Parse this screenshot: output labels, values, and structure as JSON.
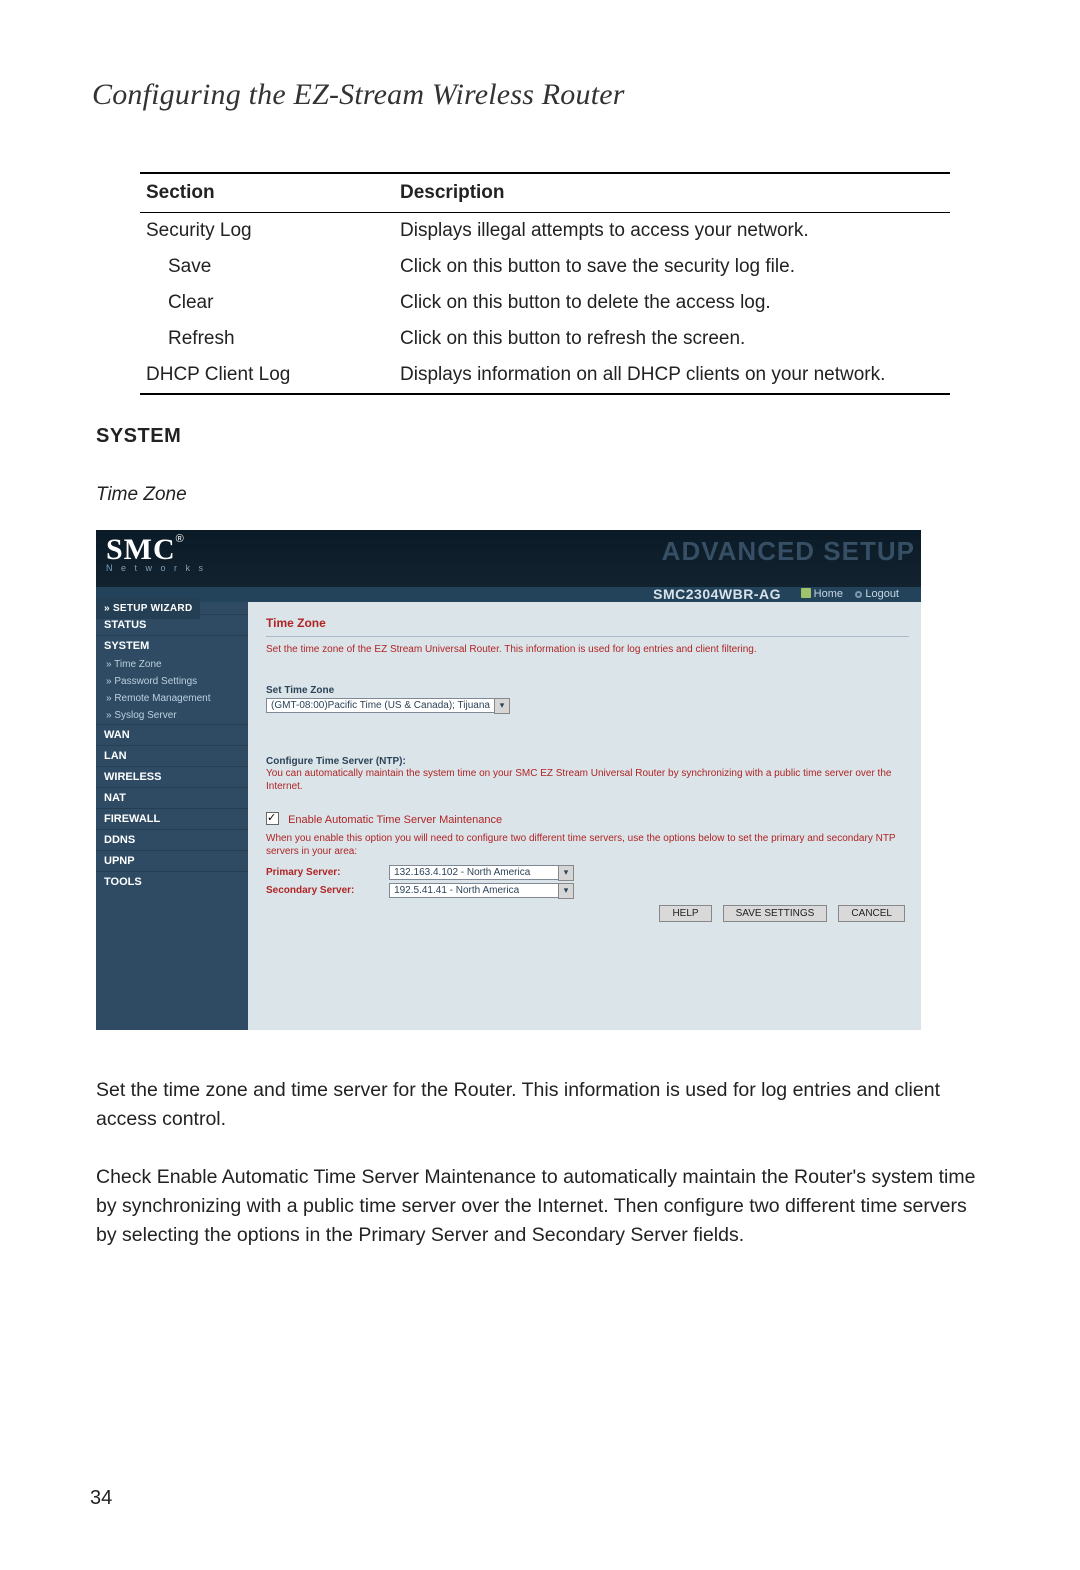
{
  "doc": {
    "page_title": "Configuring the EZ-Stream Wireless Router",
    "table": {
      "headers": {
        "c1": "Section",
        "c2": "Description"
      },
      "rows": [
        {
          "c1": "Security Log",
          "c2": "Displays illegal attempts to access your network."
        },
        {
          "c1": "Save",
          "c2": "Click on this button to save the security log file."
        },
        {
          "c1": "Clear",
          "c2": "Click on this button to delete the access log."
        },
        {
          "c1": "Refresh",
          "c2": "Click on this button to refresh the screen."
        },
        {
          "c1": "DHCP Client Log",
          "c2": "Displays information on all DHCP clients on your network."
        }
      ]
    },
    "section_heading": "SYSTEM",
    "sub_heading": "Time Zone",
    "para1": "Set the time zone and time server for the Router. This information is used for log entries and client access control.",
    "para2": "Check Enable Automatic Time Server Maintenance to automatically maintain the Router's system time by synchronizing with a public time server over the Internet. Then configure two different time servers by selecting the options in the Primary Server and Secondary Server fields.",
    "page_number": "34"
  },
  "shot": {
    "brand": "SMC",
    "brand_sub": "N e t w o r k s",
    "advanced": "ADVANCED SETUP",
    "model": "SMC2304WBR-AG",
    "home": "Home",
    "logout": "Logout",
    "sidebar": {
      "wizard": "» SETUP WIZARD",
      "items": [
        "STATUS",
        "SYSTEM"
      ],
      "subitems": [
        "» Time Zone",
        "» Password Settings",
        "» Remote Management",
        "» Syslog Server"
      ],
      "items2": [
        "WAN",
        "LAN",
        "WIRELESS",
        "NAT",
        "FIREWALL",
        "DDNS",
        "UPnP",
        "TOOLS"
      ]
    },
    "panel": {
      "title": "Time Zone",
      "intro": "Set the time zone of the EZ Stream Universal Router. This information is used for log entries and client filtering.",
      "set_tz_label": "Set Time Zone",
      "tz_value": "(GMT-08:00)Pacific Time (US & Canada); Tijuana",
      "ntp_label": "Configure Time Server (NTP):",
      "ntp_text": "You can automatically maintain the system time on your SMC EZ Stream Universal Router by synchronizing with a public time server over the Internet.",
      "enable_label": "Enable Automatic Time Server Maintenance",
      "enable_checked": true,
      "note": "When you enable this option you will need to configure two different time servers, use the options below to set the primary and secondary NTP servers in your area:",
      "primary_label": "Primary Server:",
      "primary_value": "132.163.4.102 - North America",
      "secondary_label": "Secondary Server:",
      "secondary_value": "192.5.41.41 - North America",
      "buttons": {
        "help": "HELP",
        "save": "SAVE SETTINGS",
        "cancel": "CANCEL"
      }
    }
  }
}
